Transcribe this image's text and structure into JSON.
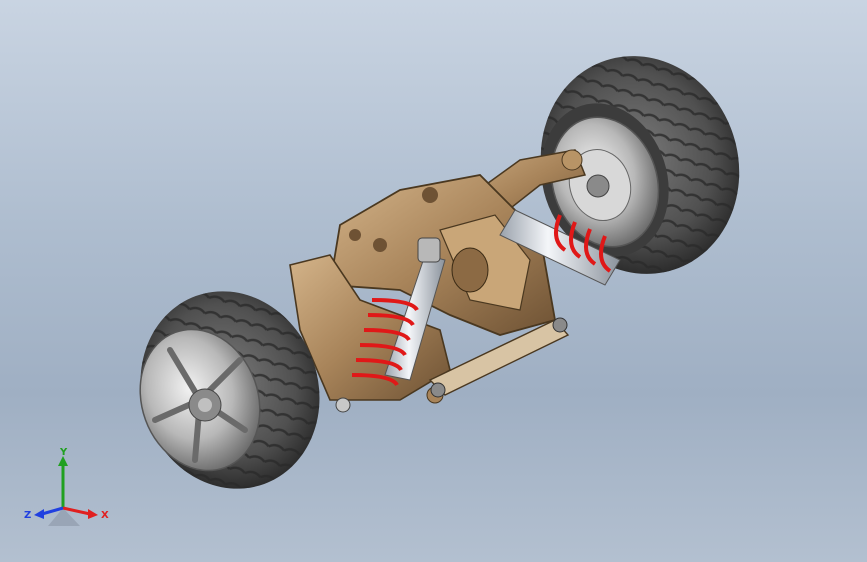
{
  "viewport": {
    "background_top": "#c9d4e2",
    "background_bottom": "#9fafc3"
  },
  "model": {
    "parts": [
      "tire-left",
      "wheel-rim-left",
      "tire-right",
      "wheel-rim-right",
      "chassis-bulkhead",
      "upper-arm",
      "lower-arm",
      "shock-absorber",
      "spring",
      "link-rod"
    ],
    "colors": {
      "tire": "#5a5a5a",
      "rim": "#c8c8c8",
      "chassis": "#a8845a",
      "spring": "#e01818",
      "shock_body": "#e8ecf2"
    }
  },
  "triad": {
    "x_label": "X",
    "y_label": "Y",
    "z_label": "Z",
    "x_color": "#e02020",
    "y_color": "#20a020",
    "z_color": "#2040e0"
  }
}
